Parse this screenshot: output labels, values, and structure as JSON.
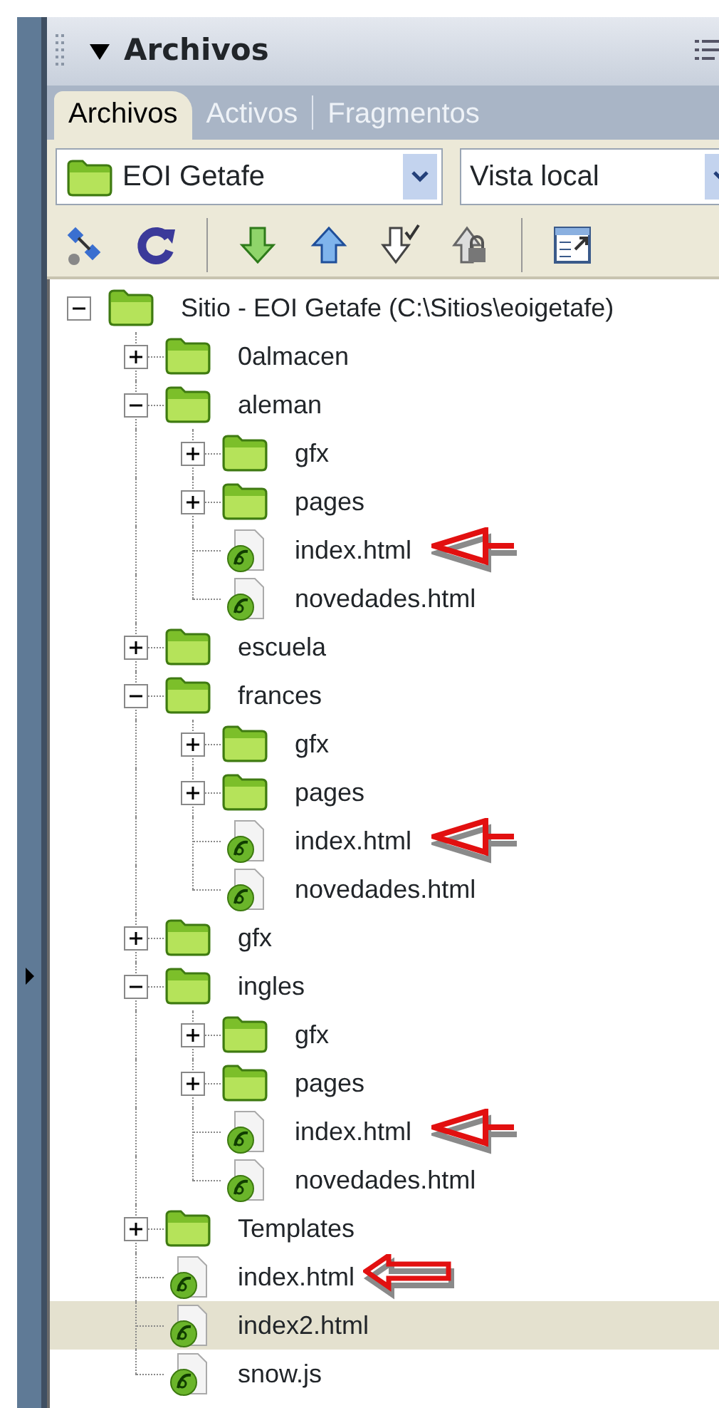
{
  "panel": {
    "title": "Archivos",
    "expanded": true
  },
  "tabs": [
    {
      "label": "Archivos",
      "selected": true
    },
    {
      "label": "Activos",
      "selected": false
    },
    {
      "label": "Fragmentos",
      "selected": false
    }
  ],
  "site_select": {
    "value": "EOI Getafe"
  },
  "view_select": {
    "value": "Vista local"
  },
  "tree": {
    "label": "Sitio - EOI Getafe (C:\\Sitios\\eoigetafe)",
    "kind": "folder",
    "expanded": true,
    "selected": false,
    "children": [
      {
        "label": "0almacen",
        "kind": "folder",
        "expanded": false,
        "selected": false
      },
      {
        "label": "aleman",
        "kind": "folder",
        "expanded": true,
        "selected": false,
        "children": [
          {
            "label": "gfx",
            "kind": "folder",
            "expanded": false,
            "selected": false
          },
          {
            "label": "pages",
            "kind": "folder",
            "expanded": false,
            "selected": false
          },
          {
            "label": "index.html",
            "kind": "file",
            "selected": false,
            "annotation": {
              "kind": "arrow"
            }
          },
          {
            "label": "novedades.html",
            "kind": "file",
            "selected": false
          }
        ]
      },
      {
        "label": "escuela",
        "kind": "folder",
        "expanded": false,
        "selected": false
      },
      {
        "label": "frances",
        "kind": "folder",
        "expanded": true,
        "selected": false,
        "children": [
          {
            "label": "gfx",
            "kind": "folder",
            "expanded": false,
            "selected": false
          },
          {
            "label": "pages",
            "kind": "folder",
            "expanded": false,
            "selected": false
          },
          {
            "label": "index.html",
            "kind": "file",
            "selected": false,
            "annotation": {
              "kind": "arrow"
            }
          },
          {
            "label": "novedades.html",
            "kind": "file",
            "selected": false
          }
        ]
      },
      {
        "label": "gfx",
        "kind": "folder",
        "expanded": false,
        "selected": false
      },
      {
        "label": "ingles",
        "kind": "folder",
        "expanded": true,
        "selected": false,
        "children": [
          {
            "label": "gfx",
            "kind": "folder",
            "expanded": false,
            "selected": false
          },
          {
            "label": "pages",
            "kind": "folder",
            "expanded": false,
            "selected": false
          },
          {
            "label": "index.html",
            "kind": "file",
            "selected": false,
            "annotation": {
              "kind": "arrow"
            }
          },
          {
            "label": "novedades.html",
            "kind": "file",
            "selected": false
          }
        ]
      },
      {
        "label": "Templates",
        "kind": "folder",
        "expanded": false,
        "selected": false
      },
      {
        "label": "index.html",
        "kind": "file",
        "selected": false,
        "annotation": {
          "kind": "block-arrow"
        }
      },
      {
        "label": "index2.html",
        "kind": "file",
        "selected": true
      },
      {
        "label": "snow.js",
        "kind": "file",
        "selected": false
      }
    ]
  }
}
